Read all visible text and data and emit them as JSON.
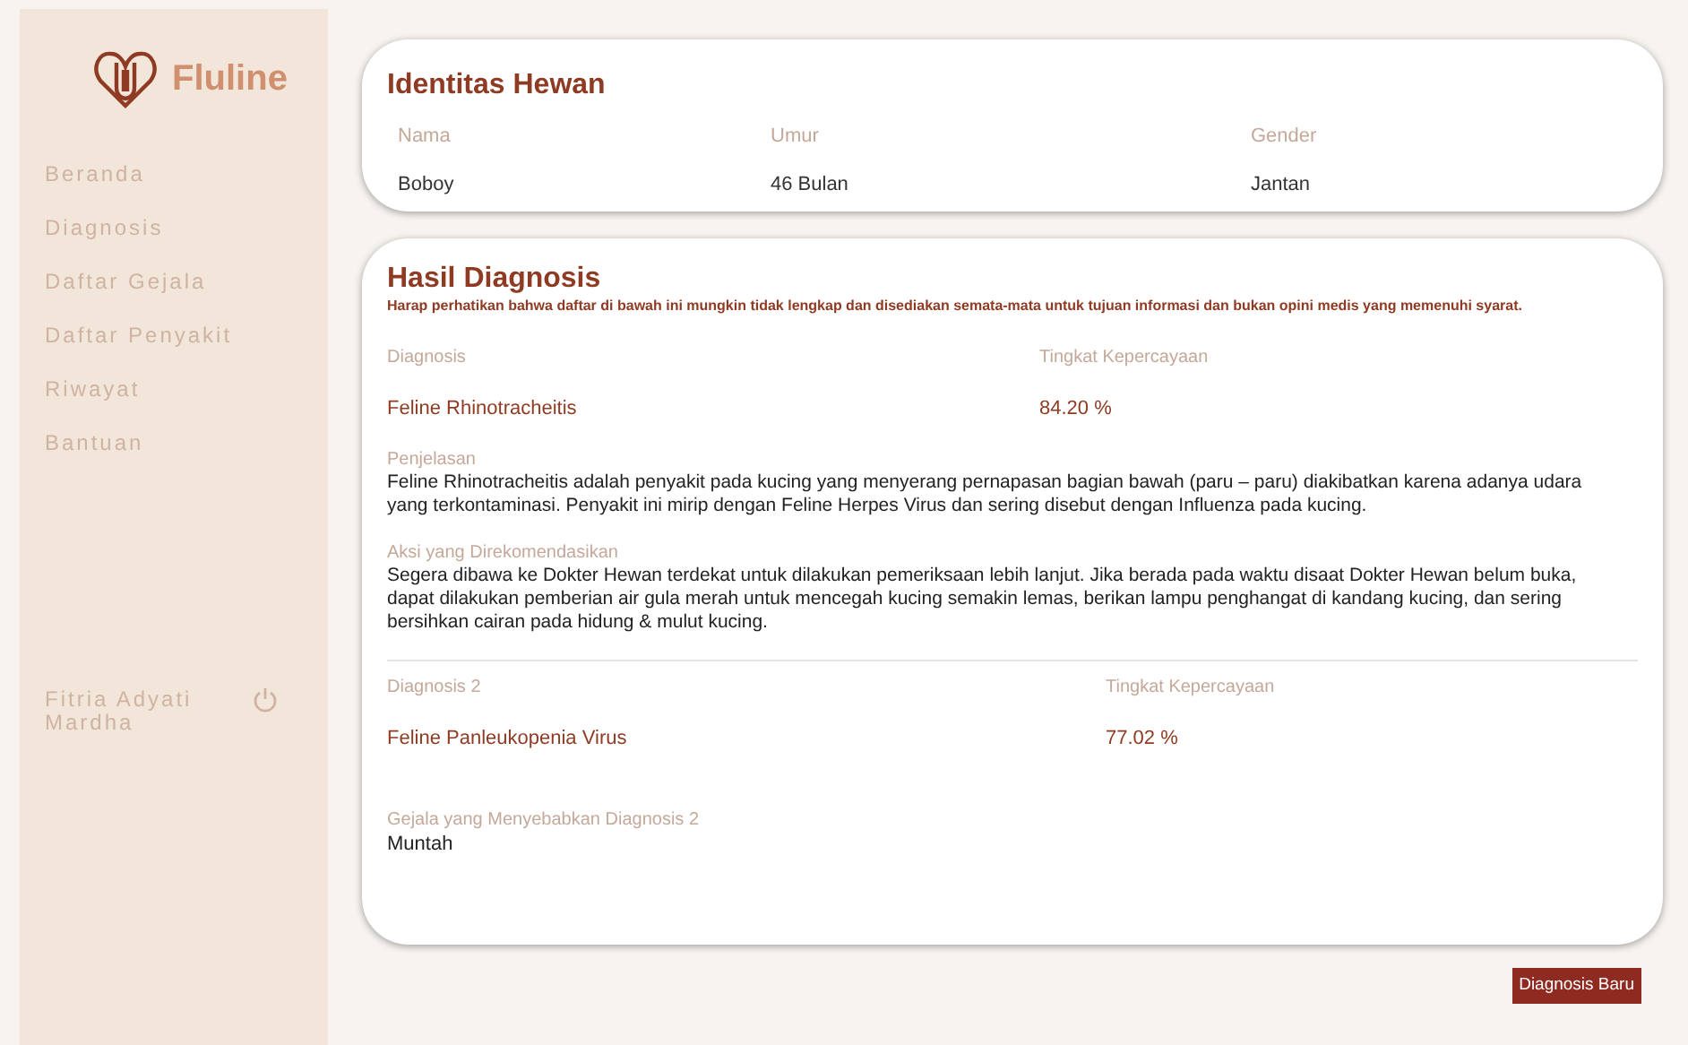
{
  "sidebar": {
    "brand": "Fluline",
    "items": [
      {
        "label": "Beranda"
      },
      {
        "label": "Diagnosis"
      },
      {
        "label": "Daftar Gejala"
      },
      {
        "label": "Daftar Penyakit"
      },
      {
        "label": "Riwayat"
      },
      {
        "label": "Bantuan"
      }
    ],
    "user": "Fitria Adyati Mardha"
  },
  "identity": {
    "title": "Identitas Hewan",
    "fields": [
      {
        "label": "Nama",
        "value": "Boboy"
      },
      {
        "label": "Umur",
        "value": "46 Bulan"
      },
      {
        "label": "Gender",
        "value": "Jantan"
      }
    ]
  },
  "result": {
    "title": "Hasil Diagnosis",
    "disclaimer": "Harap perhatikan bahwa daftar di bawah ini mungkin tidak lengkap dan disediakan semata-mata untuk tujuan informasi dan bukan opini medis yang memenuhi syarat.",
    "primary": {
      "diagnosis_label": "Diagnosis",
      "diagnosis": "Feline Rhinotracheitis",
      "confidence_label": "Tingkat Kepercayaan",
      "confidence": "84.20 %"
    },
    "sections": [
      {
        "label": "Penjelasan",
        "text": "Feline Rhinotracheitis adalah penyakit pada kucing yang menyerang pernapasan bagian bawah (paru – paru) diakibatkan karena adanya udara yang terkontaminasi. Penyakit ini mirip dengan Feline Herpes Virus dan sering disebut dengan Influenza pada kucing."
      },
      {
        "label": "Aksi yang Direkomendasikan",
        "text": "Segera dibawa ke Dokter Hewan terdekat untuk dilakukan pemeriksaan lebih lanjut. Jika berada pada waktu disaat Dokter Hewan belum buka, dapat dilakukan pemberian air gula merah untuk mencegah kucing semakin lemas, berikan lampu penghangat di kandang kucing, dan sering bersihkan cairan pada hidung & mulut kucing."
      }
    ],
    "secondary": {
      "diagnosis_label": "Diagnosis 2",
      "diagnosis": "Feline Panleukopenia Virus",
      "confidence_label": "Tingkat Kepercayaan",
      "confidence": "77.02 %"
    },
    "symptoms": {
      "label": "Gejala yang Menyebabkan Diagnosis 2",
      "text": "Muntah"
    }
  },
  "button": "Diagnosis Baru"
}
